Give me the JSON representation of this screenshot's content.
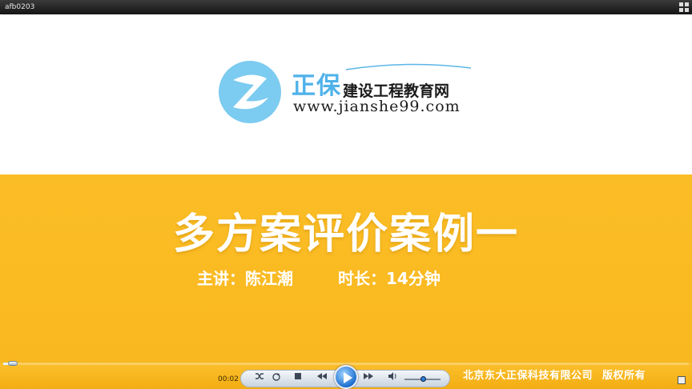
{
  "window": {
    "title": "afb0203"
  },
  "slide": {
    "brand_name_big": "正保",
    "brand_name_small": "建设工程教育网",
    "brand_url": "www.jianshe99.com",
    "course_title": "多方案评价案例一",
    "lecturer": "主讲：陈江潮",
    "duration": "时长：14分钟",
    "colors": {
      "yellow": "#fbbd26",
      "logo_blue": "#7ccbf0",
      "brand_blue": "#4fb2ea"
    }
  },
  "player": {
    "current_time": "00:02",
    "progress_fraction": 0.012,
    "volume_fraction": 0.5,
    "copyright_company": "北京东大正保科技有限公司",
    "copyright_rights": "版权所有",
    "icons": [
      "shuffle-icon",
      "repeat-icon",
      "stop-icon",
      "rewind-icon",
      "play-icon",
      "fast-forward-icon",
      "volume-icon",
      "fullscreen-icon"
    ]
  }
}
